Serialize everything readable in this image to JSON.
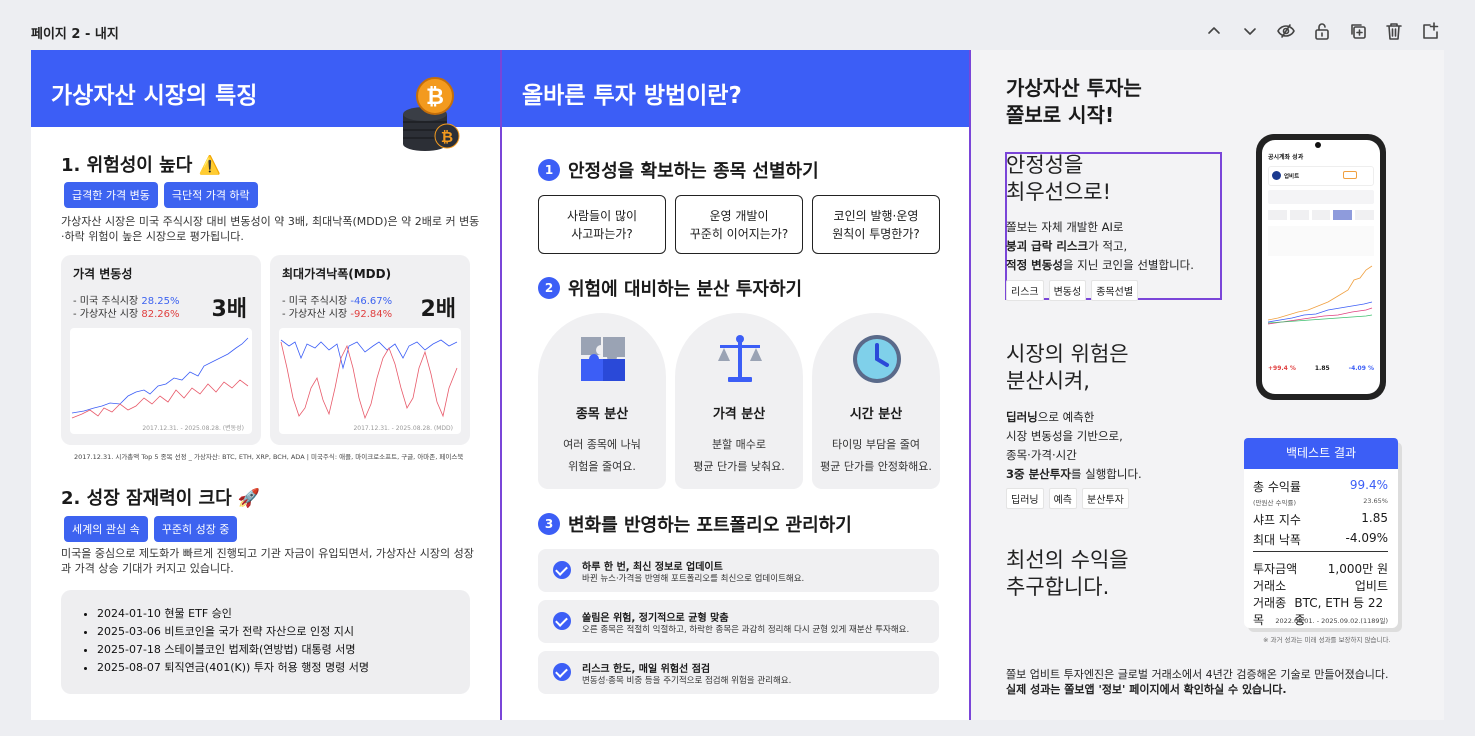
{
  "page_label": "페이지 2 - 내지",
  "toolbar": {
    "icons": [
      "chevron-up-icon",
      "chevron-down-icon",
      "hide-icon",
      "unlock-icon",
      "duplicate-icon",
      "trash-icon",
      "add-page-icon"
    ]
  },
  "p1": {
    "header": "가상자산 시장의 특징",
    "s1": {
      "title": "1. 위험성이 높다 ⚠️",
      "chips": [
        "급격한 가격 변동",
        "극단적 가격 하락"
      ],
      "text": "가상자산 시장은 미국 주식시장 대비 변동성이 약 3배, 최대낙폭(MDD)은 약 2배로 커 변동·하락 위험이 높은 시장으로 평가됩니다."
    },
    "card1": {
      "title": "가격 변동성",
      "l1": "- 미국 주식시장",
      "v1": "28.25%",
      "l2": "- 가상자산 시장",
      "v2": "82.26%",
      "big": "3배",
      "range": "2017.12.31. - 2025.08.28. (변동성)"
    },
    "card2": {
      "title": "최대가격낙폭(MDD)",
      "l1": "- 미국 주식시장",
      "v1": "-46.67%",
      "l2": "- 가상자산 시장",
      "v2": "-92.84%",
      "big": "2배",
      "range": "2017.12.31. - 2025.08.28. (MDD)"
    },
    "footnote": "2017.12.31. 시가총액 Top 5 종목 선정 _ 가상자산: BTC, ETH, XRP, BCH, ADA  |  미국주식: 애플, 마이크로소프트, 구글, 아마존, 페이스북",
    "s2": {
      "title": "2. 성장 잠재력이 크다 🚀",
      "chips": [
        "세계의 관심 속",
        "꾸준히 성장 중"
      ],
      "text": "미국을 중심으로 제도화가 빠르게 진행되고 기관 자금이 유입되면서, 가상자산 시장의 성장과 가격 상승 기대가 커지고 있습니다."
    },
    "news": [
      "2024-01-10 현물 ETF 승인",
      "2025-03-06 비트코인을 국가 전략 자산으로 인정 지시",
      "2025-07-18 스테이블코인 법제화(연방법) 대통령 서명",
      "2025-08-07 퇴직연금(401(K)) 투자 허용 행정 명령 서명"
    ]
  },
  "p2": {
    "header": "올바른 투자 방법이란?",
    "s1": {
      "num": "1",
      "title": "안정성을 확보하는 종목 선별하기",
      "boxes": [
        [
          "사람들이 많이",
          "사고파는가?"
        ],
        [
          "운영 개발이",
          "꾸준히 이어지는가?"
        ],
        [
          "코인의 발행·운영",
          "원칙이 투명한가?"
        ]
      ]
    },
    "s2": {
      "num": "2",
      "title": "위험에 대비하는 분산 투자하기",
      "cards": [
        {
          "h": "종목 분산",
          "d1": "여러 종목에 나눠",
          "d2": "위험을 줄여요."
        },
        {
          "h": "가격 분산",
          "d1": "분할 매수로",
          "d2": "평균 단가를 낮춰요."
        },
        {
          "h": "시간 분산",
          "d1": "타이밍 부담을 줄여",
          "d2": "평균 단가를 안정화해요."
        }
      ]
    },
    "s3": {
      "num": "3",
      "title": "변화를 반영하는 포트폴리오 관리하기",
      "items": [
        {
          "a": "하루 한 번, 최신 정보로 업데이트",
          "b": "바뀐 뉴스·가격을 반영해 포트폴리오를 최신으로 업데이트해요."
        },
        {
          "a": "쏠림은 위험, 정기적으로 균형 맞춤",
          "b": "오른 종목은 적절히 익절하고, 하락한 종목은 과감히 정리해 다시 균형 있게 재분산 투자해요."
        },
        {
          "a": "리스크 한도, 매일 위험선 점검",
          "b": "변동성·종목 비중 등을 주기적으로 점검해 위험을 관리해요."
        }
      ]
    }
  },
  "p3": {
    "title1": "가상자산 투자는",
    "title2": "쫄보로 시작!",
    "b1": {
      "h1": "안정성을",
      "h2": "최우선으로!",
      "t1": "쫄보는 자체 개발한 AI로",
      "t2b": "붕괴 급락 리스크",
      "t2": "가 적고,",
      "t3b": "적정 변동성",
      "t3": "을 지닌 코인을 선별합니다.",
      "tags": [
        "리스크",
        "변동성",
        "종목선별"
      ]
    },
    "b2": {
      "h1": "시장의 위험은",
      "h2": "분산시켜,",
      "t1b": "딥러닝",
      "t1": "으로 예측한",
      "t2": "시장 변동성을 기반으로,",
      "t3": "종목·가격·시간",
      "t4b": "3중 분산투자",
      "t4": "를 실행합니다.",
      "tags": [
        "딥러닝",
        "예측",
        "분산투자"
      ]
    },
    "b3": {
      "h1": "최선의 수익을",
      "h2": "추구합니다."
    },
    "phone": {
      "title": "공시계좌 성과",
      "brand": "업비트",
      "stats": [
        "+99.4 %",
        "1.85",
        "-4.09 %"
      ]
    },
    "backtest": {
      "title": "백테스트 결과",
      "r1": [
        "총 수익률",
        "99.4%"
      ],
      "r1s": [
        "(만원산 수익률)",
        "23.65%"
      ],
      "r2": [
        "샤프 지수",
        "1.85"
      ],
      "r3": [
        "최대 낙폭",
        "-4.09%"
      ],
      "r4": [
        "투자금액",
        "1,000만 원"
      ],
      "r5": [
        "거래소",
        "업비트"
      ],
      "r6": [
        "거래종목",
        "BTC, ETH 등 22종"
      ],
      "period": "2022.06.01. - 2025.09.02.(1189일)"
    },
    "note": "※ 과거 성과는 미래 성과를 보장하지 않습니다.",
    "bottom1": "쫄보 업비트 투자엔진은 글로벌 거래소에서 4년간 검증해온 기술로 만들어졌습니다.",
    "bottom2": "실제 성과는 쫄보앱 '정보' 페이지에서 확인하실 수 있습니다."
  },
  "colors": {
    "accent": "#3c5ef6",
    "select": "#7a45d8",
    "neg": "#e04040"
  }
}
